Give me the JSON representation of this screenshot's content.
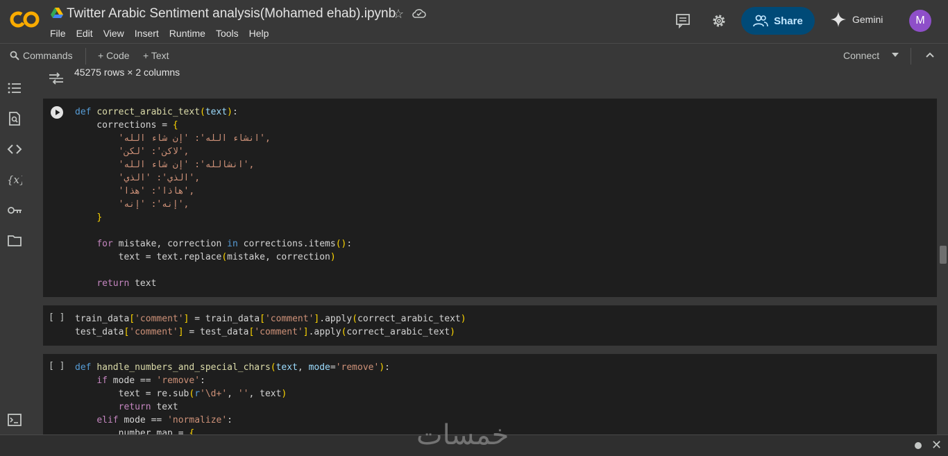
{
  "header": {
    "logo_text": "CO",
    "notebook_title": "Twitter Arabic Sentiment analysis(Mohamed ehab).ipynb",
    "menu": [
      "File",
      "Edit",
      "View",
      "Insert",
      "Runtime",
      "Tools",
      "Help"
    ],
    "share_label": "Share",
    "gemini_label": "Gemini",
    "avatar_letter": "M"
  },
  "toolbar": {
    "commands_label": "Commands",
    "code_label": "+ Code",
    "text_label": "+ Text",
    "connect_label": "Connect"
  },
  "output": {
    "dims_text": "45275 rows × 2 columns"
  },
  "cells": [
    {
      "exec_label": "",
      "lines": [
        "def correct_arabic_text(text):",
        "    corrections = {",
        "        'انشاء الله': 'إن شاء الله',",
        "        'لاكن': 'لكن',",
        "        'انشالله': 'إن شاء الله',",
        "        'الذي': 'الذي',",
        "        'هاذا': 'هذا',",
        "        'إنه': 'إنه',",
        "    }",
        "",
        "    for mistake, correction in corrections.items():",
        "        text = text.replace(mistake, correction)",
        "",
        "    return text"
      ]
    },
    {
      "exec_label": "[ ]",
      "lines": [
        "train_data['comment'] = train_data['comment'].apply(correct_arabic_text)",
        "test_data['comment'] = test_data['comment'].apply(correct_arabic_text)"
      ]
    },
    {
      "exec_label": "[ ]",
      "lines": [
        "def handle_numbers_and_special_chars(text, mode='remove'):",
        "    if mode == 'remove':",
        "        text = re.sub(r'\\d+', '', text)",
        "        return text",
        "    elif mode == 'normalize':",
        "        number_map = {"
      ]
    }
  ],
  "watermark_text": "خمسات",
  "colors": {
    "background": "#383838",
    "cell_background": "#1e1e1e",
    "share_button": "#004a77",
    "avatar": "#8e4fc9",
    "logo_orange": "#f9ab00"
  }
}
